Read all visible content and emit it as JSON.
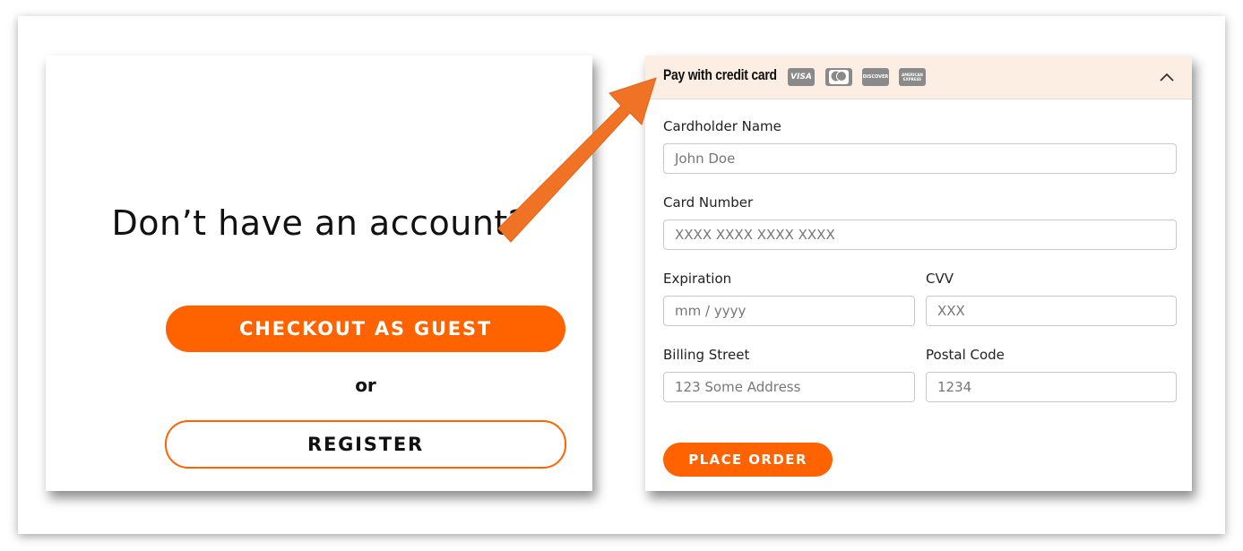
{
  "colors": {
    "accent": "#ff6300",
    "header_bg": "#fdeee4",
    "arrow": "#f07225"
  },
  "left_panel": {
    "heading": "Don’t have an account?",
    "guest_button": "CHECKOUT AS GUEST",
    "or_text": "or",
    "register_button": "REGISTER"
  },
  "payment": {
    "title": "Pay with credit card",
    "card_icons": [
      "visa-icon",
      "mastercard-icon",
      "discover-icon",
      "amex-icon"
    ],
    "visa_text": "VISA",
    "discover_text": "DISCOVER",
    "amex_text": "AMERICAN EXPRESS",
    "fields": {
      "cardholder": {
        "label": "Cardholder Name",
        "placeholder": "John Doe"
      },
      "card_number": {
        "label": "Card Number",
        "placeholder": "XXXX XXXX XXXX XXXX"
      },
      "expiration": {
        "label": "Expiration",
        "placeholder": "mm / yyyy"
      },
      "cvv": {
        "label": "CVV",
        "placeholder": "XXX"
      },
      "street": {
        "label": "Billing Street",
        "placeholder": "123 Some Address"
      },
      "postal": {
        "label": "Postal Code",
        "placeholder": "1234"
      }
    },
    "place_order": "PLACE ORDER"
  }
}
